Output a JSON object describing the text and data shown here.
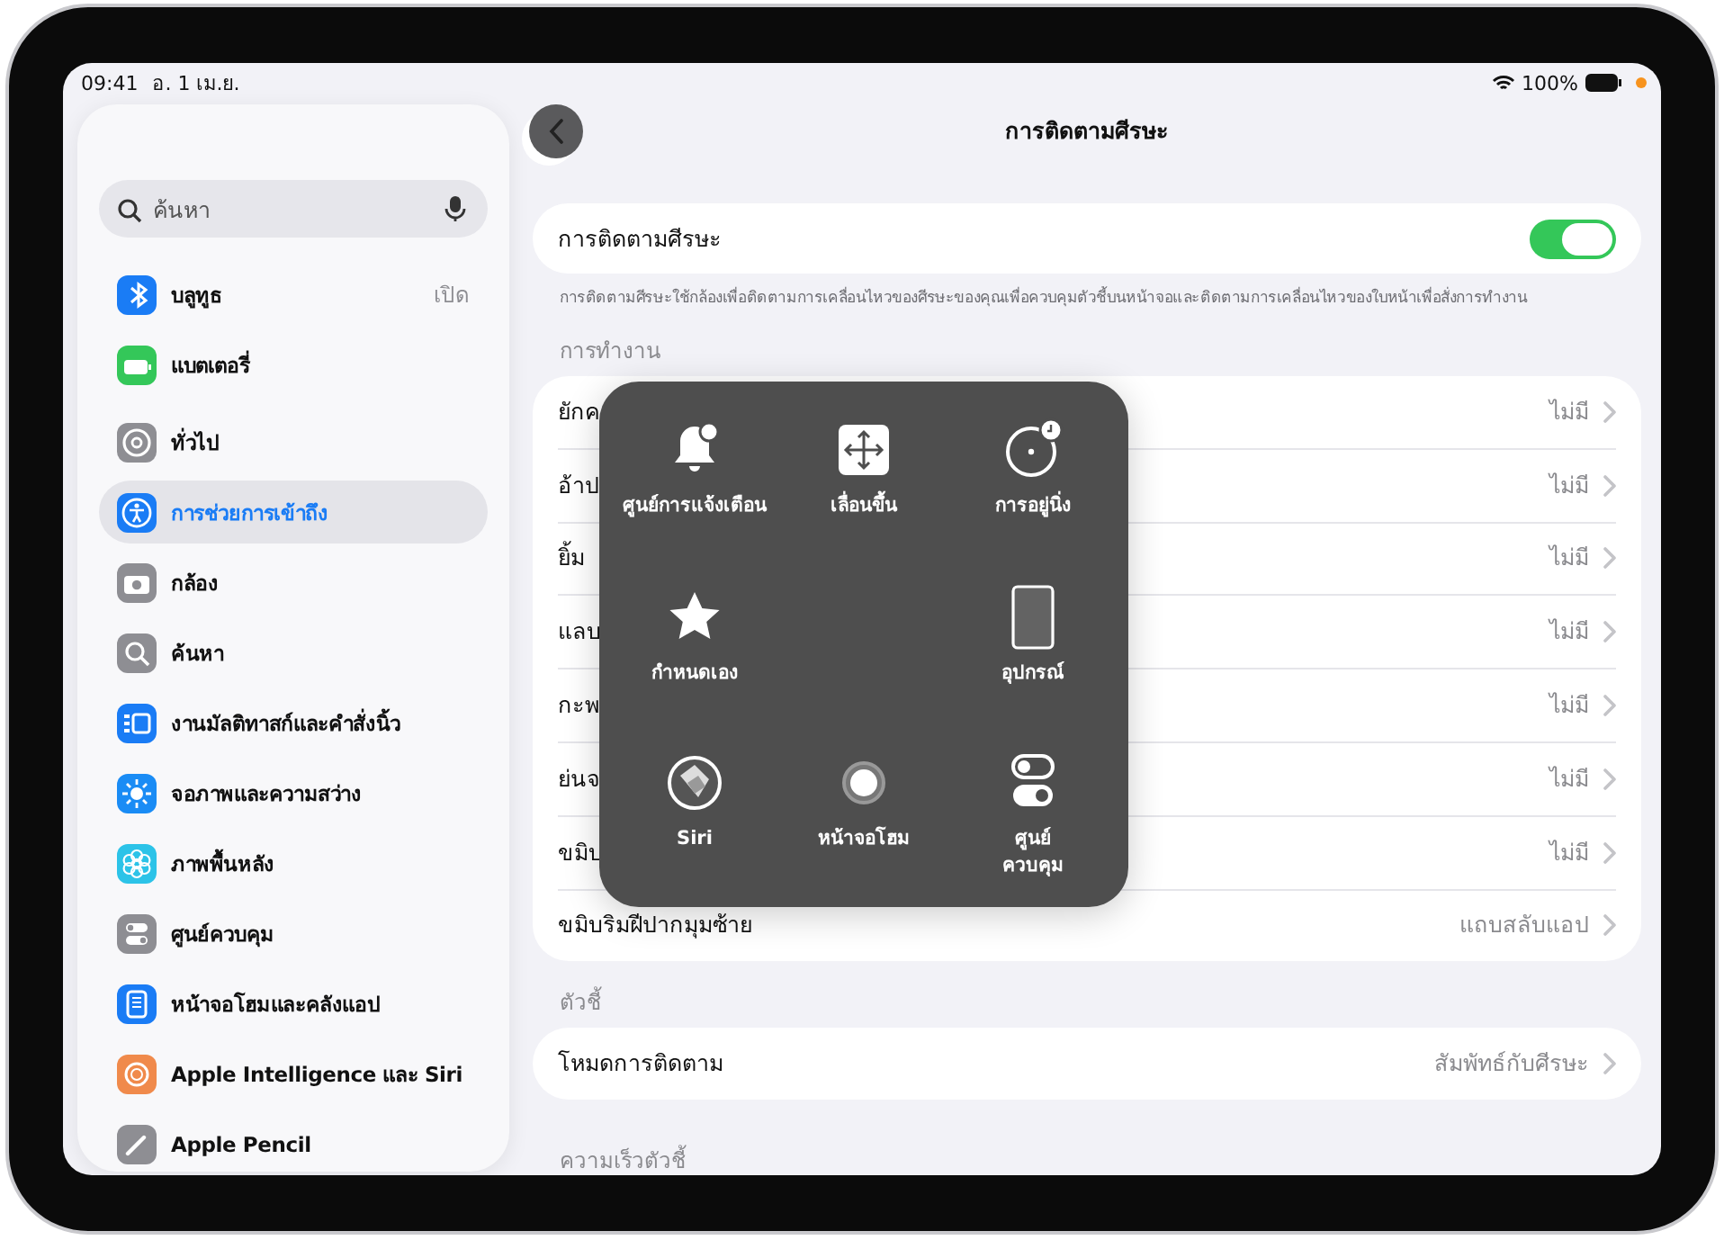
{
  "status_bar": {
    "time": "09:41",
    "date": "อ. 1 เม.ย.",
    "battery": "100%"
  },
  "sidebar": {
    "search": {
      "placeholder": "ค้นหา"
    },
    "groups": [
      {
        "items": [
          {
            "label": "บลูทูธ",
            "value": "เปิด",
            "color": "#1a7cf5",
            "selected": false
          },
          {
            "label": "แบตเตอรี่",
            "color": "#34c759",
            "selected": false
          }
        ]
      },
      {
        "items": [
          {
            "label": "ทั่วไป",
            "color": "#8e8e93",
            "selected": false
          },
          {
            "label": "การช่วยการเข้าถึง",
            "color": "#1a7cf5",
            "selected": true
          },
          {
            "label": "กล้อง",
            "color": "#8e8e93",
            "selected": false
          },
          {
            "label": "ค้นหา",
            "color": "#8e8e93",
            "selected": false
          },
          {
            "label": "งานมัลติทาสก์และคำสั่งนิ้ว",
            "color": "#1a7cf5",
            "selected": false
          },
          {
            "label": "จอภาพและความสว่าง",
            "color": "#1a8cf5",
            "selected": false
          },
          {
            "label": "ภาพพื้นหลัง",
            "color": "#2cc3e8",
            "selected": false
          },
          {
            "label": "ศูนย์ควบคุม",
            "color": "#8e8e93",
            "selected": false
          },
          {
            "label": "หน้าจอโฮมและคลังแอป",
            "color": "#1a7cf5",
            "selected": false
          },
          {
            "label": "Apple Intelligence และ Siri",
            "color": "#f08a4b",
            "selected": false
          },
          {
            "label": "Apple Pencil",
            "color": "#8e8e93",
            "selected": false
          }
        ]
      }
    ]
  },
  "detail": {
    "title": "การติดตามศีรษะ",
    "toggle": {
      "label": "การติดตามศีรษะ",
      "on": true
    },
    "description": "การติดตามศีรษะใช้กล้องเพื่อติดตามการเคลื่อนไหวของศีรษะของคุณเพื่อควบคุมตัวชี้บนหน้าจอและติดตามการเคลื่อนไหวของใบหน้าเพื่อสั่งการทำงาน",
    "actions_header": "การทำงาน",
    "actions": [
      {
        "label": "ยักค",
        "value": "ไม่มี"
      },
      {
        "label": "อ้าป",
        "value": "ไม่มี"
      },
      {
        "label": "ยิ้ม",
        "value": "ไม่มี"
      },
      {
        "label": "แลบ",
        "value": "ไม่มี"
      },
      {
        "label": "กะพ",
        "value": "ไม่มี"
      },
      {
        "label": "ย่นจ",
        "value": "ไม่มี"
      },
      {
        "label": "ขมิบ",
        "value": "ไม่มี"
      },
      {
        "label": "ขมิบริมฝีปากมุมซ้าย",
        "value": "แถบสลับแอป"
      }
    ],
    "pointer_header": "ตัวชี้",
    "pointer": [
      {
        "label": "โหมดการติดตาม",
        "value": "สัมพัทธ์กับศีรษะ"
      }
    ],
    "speed_header": "ความเร็วตัวชี้"
  },
  "menu": {
    "items": [
      {
        "label": "ศูนย์การแจ้งเตือน"
      },
      {
        "label": "เลื่อนขึ้น"
      },
      {
        "label": "การอยู่นิ่ง"
      },
      {
        "label": "กำหนดเอง"
      },
      {
        "label": "อุปกรณ์"
      },
      {
        "label": "Siri"
      },
      {
        "label": "หน้าจอโฮม"
      },
      {
        "label": "ศูนย์\nควบคุม"
      }
    ]
  }
}
